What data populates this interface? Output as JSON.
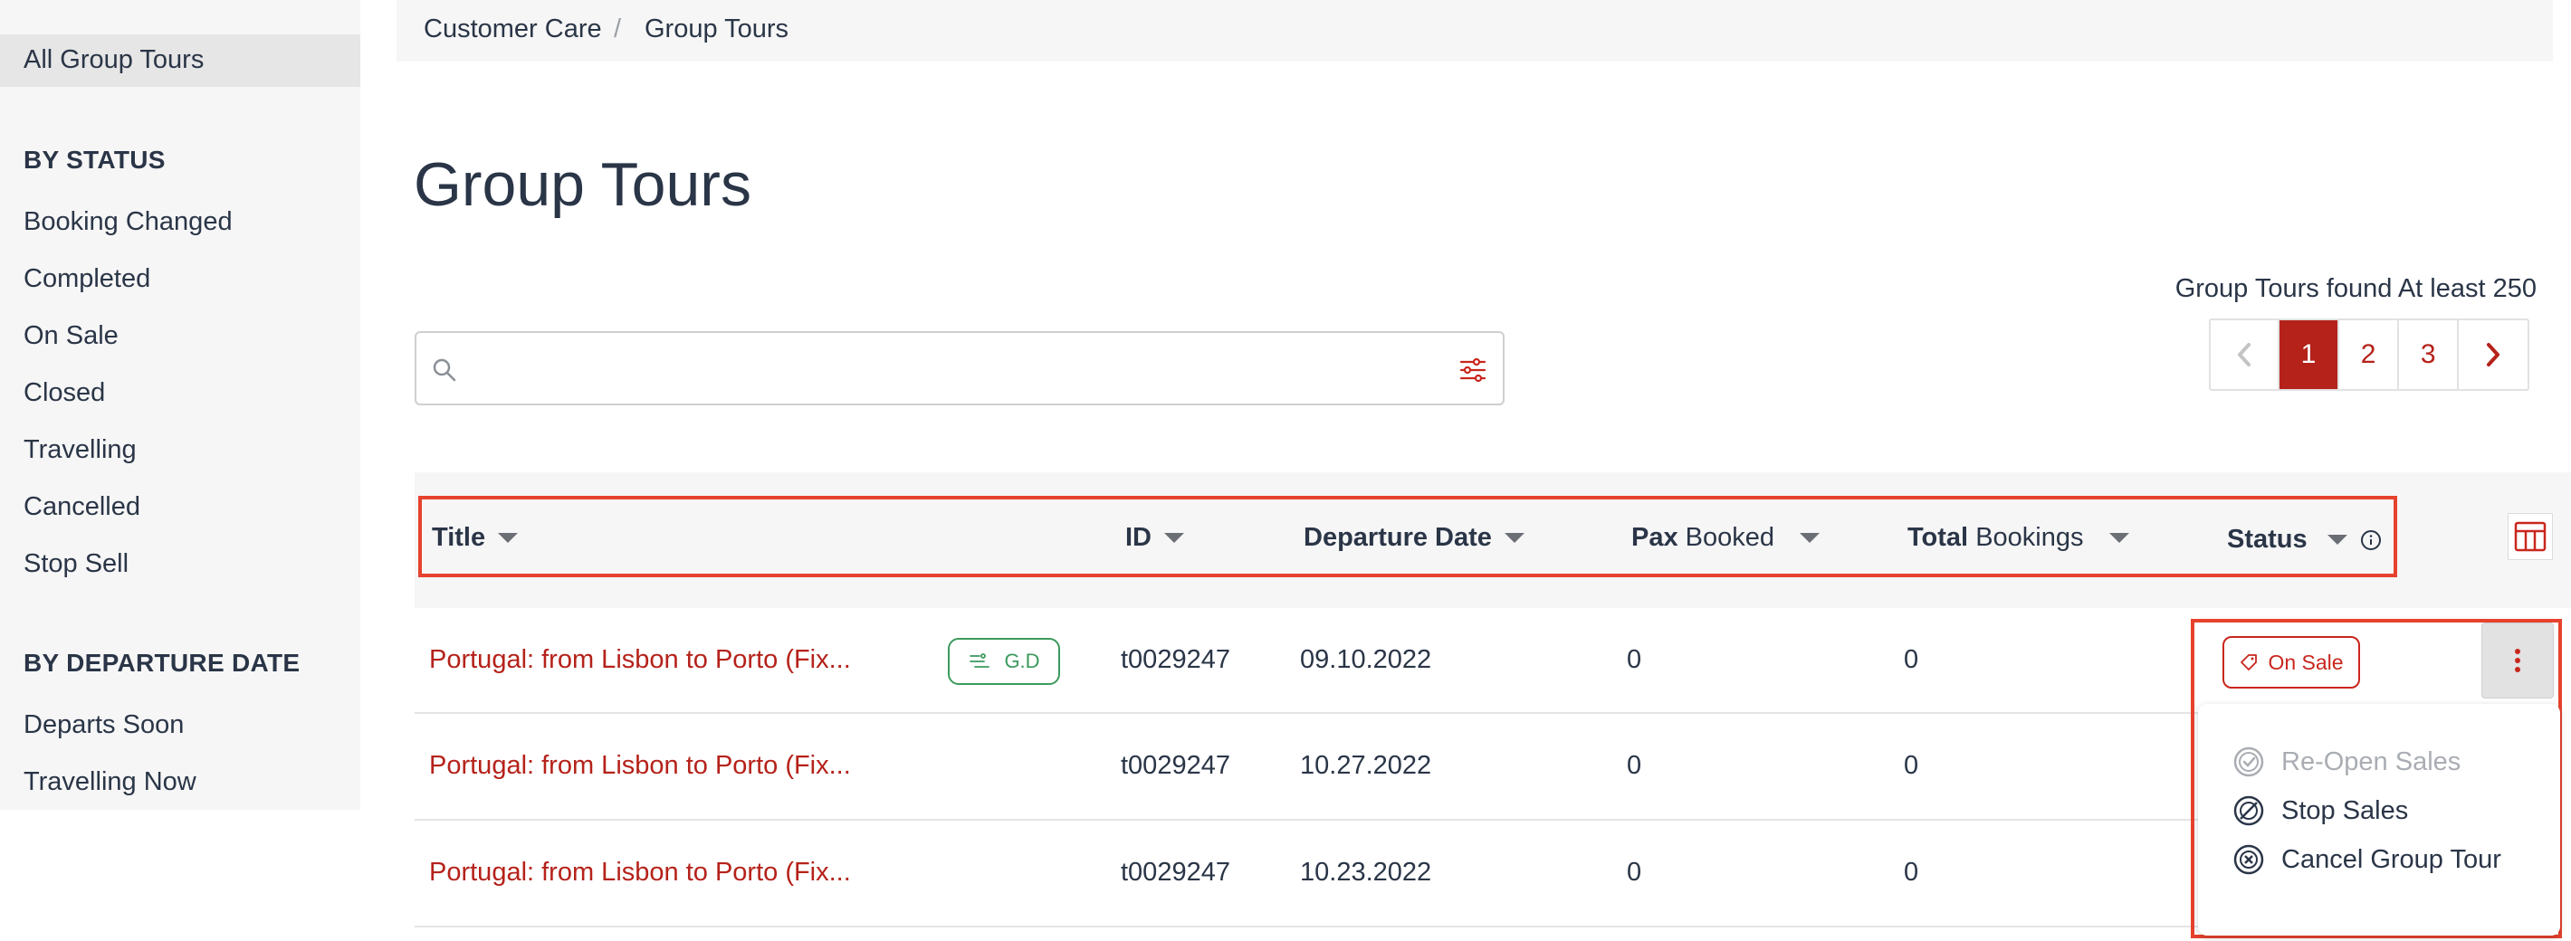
{
  "breadcrumb": [
    "Customer Care",
    "Group Tours"
  ],
  "sidebar": {
    "all_label": "All Group Tours",
    "status_heading": "BY STATUS",
    "status_items": [
      "Booking Changed",
      "Completed",
      "On Sale",
      "Closed",
      "Travelling",
      "Cancelled",
      "Stop Sell"
    ],
    "date_heading": "BY DEPARTURE DATE",
    "date_items": [
      "Departs Soon",
      "Travelling Now"
    ]
  },
  "page_title": "Group Tours",
  "search": {
    "value": "",
    "placeholder": ""
  },
  "found_text": "Group Tours found At least 250",
  "pagination": {
    "pages": [
      "1",
      "2",
      "3"
    ],
    "active": "1"
  },
  "table": {
    "headers": {
      "title": "Title",
      "id": "ID",
      "departure": "Departure Date",
      "pax_bold": "Pax",
      "pax_rest": "Booked",
      "total_bold": "Total",
      "total_rest": "Bookings",
      "status": "Status"
    },
    "rows": [
      {
        "title": "Portugal: from Lisbon to Porto (Fix...",
        "badge": "G.D",
        "id": "t0029247",
        "departure": "09.10.2022",
        "pax": "0",
        "total": "0",
        "status": "On Sale"
      },
      {
        "title": "Portugal: from Lisbon to Porto (Fix...",
        "id": "t0029247",
        "departure": "10.27.2022",
        "pax": "0",
        "total": "0"
      },
      {
        "title": "Portugal: from Lisbon to Porto (Fix...",
        "id": "t0029247",
        "departure": "10.23.2022",
        "pax": "0",
        "total": "0"
      }
    ]
  },
  "actions_menu": {
    "items": [
      {
        "label": "Re-Open Sales",
        "disabled": true
      },
      {
        "label": "Stop Sales",
        "disabled": false
      },
      {
        "label": "Cancel Group Tour",
        "disabled": false
      }
    ]
  },
  "colors": {
    "accent": "#b5221a",
    "highlight": "#e6422d",
    "badge_green": "#3a9a5c",
    "text": "#2a3547"
  },
  "icons": [
    "search-icon",
    "filter-icon",
    "chevron-left-icon",
    "chevron-right-icon",
    "sort-caret-icon",
    "info-icon",
    "columns-icon",
    "group-departure-icon",
    "tag-icon",
    "kebab-icon",
    "reopen-icon",
    "stop-icon",
    "cancel-icon"
  ]
}
